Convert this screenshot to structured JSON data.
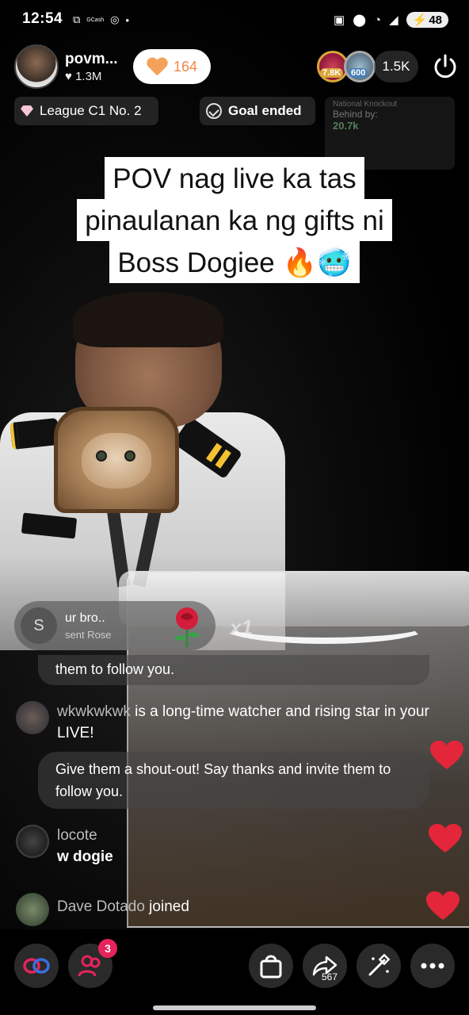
{
  "status_bar": {
    "time": "12:54",
    "left_icons": [
      "screen-record-icon",
      "gcash-icon",
      "app-icon",
      "dot-icon"
    ],
    "gcash_label": "GCash",
    "right_icons": [
      "cast-icon",
      "location-icon",
      "wifi-icon",
      "signal-icon"
    ],
    "battery": "48"
  },
  "host": {
    "name": "povm...",
    "likes": "1.3M",
    "follow_count": "164"
  },
  "viewers": {
    "badge1": "7.8K",
    "badge2": "600",
    "count": "1.5K"
  },
  "chips": {
    "league": "League C1 No. 2",
    "goal": "Goal ended",
    "knockout_title": "National Knockout",
    "knockout_label": "Behind by:",
    "knockout_value": "20.7k"
  },
  "caption": {
    "line1": "POV nag live ka tas",
    "line2": "pinaulanan ka ng gifts ni",
    "line3": "Boss Dogiee 🔥🥶"
  },
  "gift": {
    "avatar_letter": "S",
    "user": "ur bro..",
    "action": "sent Rose",
    "multiplier": "x1"
  },
  "chat": {
    "sys1_tail": "them to follow you.",
    "msg1_user": "wkwkwkwk",
    "msg1_text": " is a long-time watcher and rising star in your LIVE!",
    "sys2": "Give them a shout-out! Say thanks and invite them to follow you.",
    "msg2_user": "locote",
    "msg2_text": "w dogie",
    "msg3_user": "Dave Dotado",
    "msg3_text": " joined"
  },
  "bottom": {
    "notification_count": "3",
    "share_count": "567"
  },
  "colors": {
    "accent_pink": "#e6245c",
    "follow_orange": "#f08a4a",
    "like_red": "#e3263a"
  }
}
